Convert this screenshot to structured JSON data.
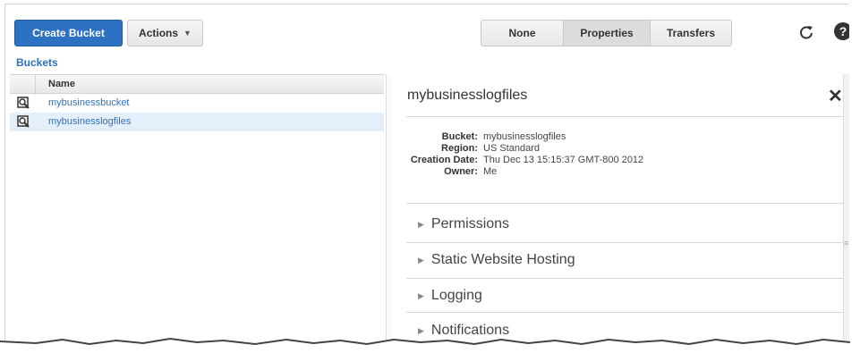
{
  "toolbar": {
    "create_label": "Create Bucket",
    "actions_label": "Actions",
    "view_options": [
      {
        "label": "None",
        "active": false
      },
      {
        "label": "Properties",
        "active": true
      },
      {
        "label": "Transfers",
        "active": false
      }
    ],
    "refresh_icon": "refresh-icon",
    "help_icon": "help-icon",
    "help_glyph": "?"
  },
  "breadcrumb": "Buckets",
  "table": {
    "column_name": "Name",
    "rows": [
      {
        "name": "mybusinessbucket",
        "selected": false
      },
      {
        "name": "mybusinesslogfiles",
        "selected": true
      }
    ]
  },
  "panel": {
    "title": "mybusinesslogfiles",
    "properties": [
      {
        "key": "Bucket:",
        "value": "mybusinesslogfiles"
      },
      {
        "key": "Region:",
        "value": "US Standard"
      },
      {
        "key": "Creation Date:",
        "value": "Thu Dec 13 15:15:37 GMT-800 2012"
      },
      {
        "key": "Owner:",
        "value": "Me"
      }
    ],
    "sections": [
      "Permissions",
      "Static Website Hosting",
      "Logging",
      "Notifications"
    ]
  },
  "colors": {
    "accent": "#2d72c2",
    "selected_row": "#e4effb"
  }
}
